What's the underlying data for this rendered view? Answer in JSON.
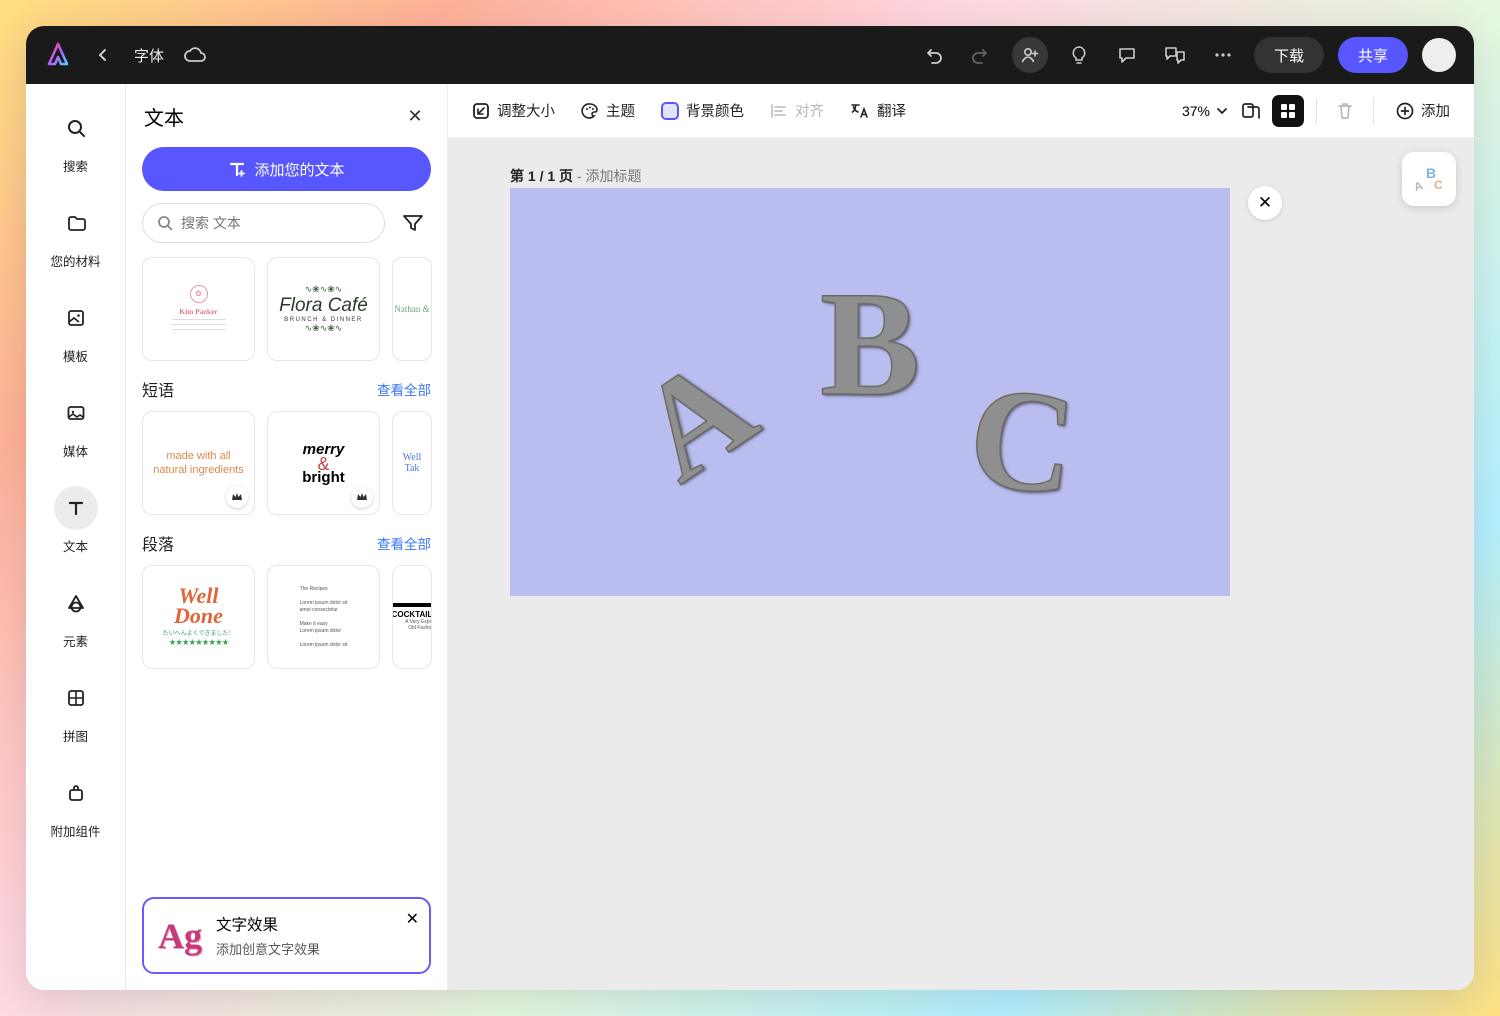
{
  "topbar": {
    "crumb": "字体",
    "download": "下载",
    "share": "共享"
  },
  "rail": {
    "items": [
      {
        "label": "搜索",
        "icon": "search"
      },
      {
        "label": "您的材料",
        "icon": "folder"
      },
      {
        "label": "模板",
        "icon": "template"
      },
      {
        "label": "媒体",
        "icon": "media"
      },
      {
        "label": "文本",
        "icon": "text",
        "active": true
      },
      {
        "label": "元素",
        "icon": "shape"
      },
      {
        "label": "拼图",
        "icon": "grid"
      },
      {
        "label": "附加组件",
        "icon": "addon"
      }
    ]
  },
  "sidepanel": {
    "title": "文本",
    "add_text": "添加您的文本",
    "search_placeholder": "搜索 文本",
    "sections": {
      "phrases": {
        "title": "短语",
        "link": "查看全部"
      },
      "paragraphs": {
        "title": "段落",
        "link": "查看全部"
      }
    },
    "sample_cards": {
      "kim": "Kim Parker",
      "flora_title": "Flora Café",
      "flora_sub": "BRUNCH & DINNER",
      "nathan": "Nathan &",
      "made_with_1": "made with all",
      "made_with_2": "natural ingredients",
      "merry_top": "merry",
      "merry_amp": "&",
      "merry_bot": "bright",
      "well_take": "Well\nTak",
      "welldone": "Well\nDone",
      "welldone_jp": "たいへんよくできました！",
      "welldone_stars": "★★★★★★★★★",
      "cocktail": "COCKTAIL",
      "cocktail_sub": "A Very Expe\nOld Fashio"
    },
    "fx": {
      "sample": "Ag",
      "title": "文字效果",
      "sub": "添加创意文字效果"
    }
  },
  "toolbar2": {
    "resize": "调整大小",
    "theme": "主题",
    "bg": "背景颜色",
    "align": "对齐",
    "translate": "翻译",
    "zoom": "37%",
    "add": "添加"
  },
  "canvas": {
    "page_label_a": "第 1 / 1 页",
    "page_label_b": " - 添加标题",
    "letters": {
      "a": "A",
      "b": "B",
      "c": "C"
    },
    "float_label": "ABC"
  }
}
